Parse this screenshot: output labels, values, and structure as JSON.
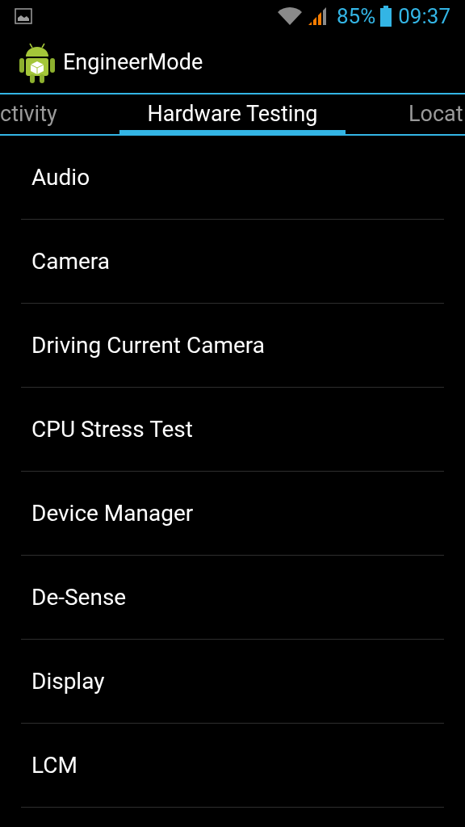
{
  "status_bar": {
    "battery": "85%",
    "time": "09:37"
  },
  "action_bar": {
    "title": "EngineerMode"
  },
  "tabs": [
    {
      "label": "ctivity",
      "selected": false
    },
    {
      "label": "Hardware Testing",
      "selected": true
    },
    {
      "label": "Locat",
      "selected": false
    }
  ],
  "items": [
    "Audio",
    "Camera",
    "Driving Current Camera",
    "CPU Stress Test",
    "Device Manager",
    "De-Sense",
    "Display",
    "LCM"
  ]
}
